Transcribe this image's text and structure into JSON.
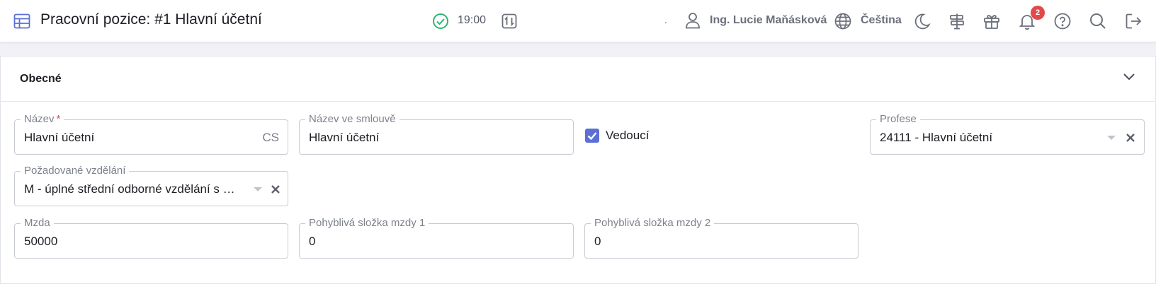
{
  "header": {
    "title": "Pracovní pozice: #1 Hlavní účetní",
    "time": "19:00",
    "separator": ".",
    "user_name": "Ing. Lucie Maňásková",
    "language": "Čeština",
    "notification_count": "2",
    "icons": [
      "table-icon",
      "check-circle-icon",
      "sort-toggle-icon",
      "user-icon",
      "globe-icon",
      "moon-icon",
      "signpost-icon",
      "gift-icon",
      "bell-icon",
      "help-icon",
      "search-icon",
      "logout-icon"
    ]
  },
  "section": {
    "title": "Obecné",
    "collapse_icon": "chevron-down-icon"
  },
  "form": {
    "name": {
      "label": "Název",
      "required_mark": "*",
      "value": "Hlavní účetní",
      "lang_tag": "CS"
    },
    "contract_name": {
      "label": "Název ve smlouvě",
      "value": "Hlavní účetní"
    },
    "manager": {
      "label": "Vedoucí",
      "checked": true
    },
    "profession": {
      "label": "Profese",
      "value": "24111 - Hlavní účetní"
    },
    "education": {
      "label": "Požadované vzdělání",
      "value": "M - úplné střední odborné vzdělání s maturitou"
    },
    "salary": {
      "label": "Mzda",
      "value": "50000"
    },
    "variable_pay_1": {
      "label": "Pohyblivá složka mzdy 1",
      "value": "0"
    },
    "variable_pay_2": {
      "label": "Pohyblivá složka mzdy 2",
      "value": "0"
    }
  },
  "colors": {
    "accent": "#5b6fd6",
    "success": "#2bb673",
    "badge": "#e14a4a",
    "required": "#e24a4a"
  }
}
